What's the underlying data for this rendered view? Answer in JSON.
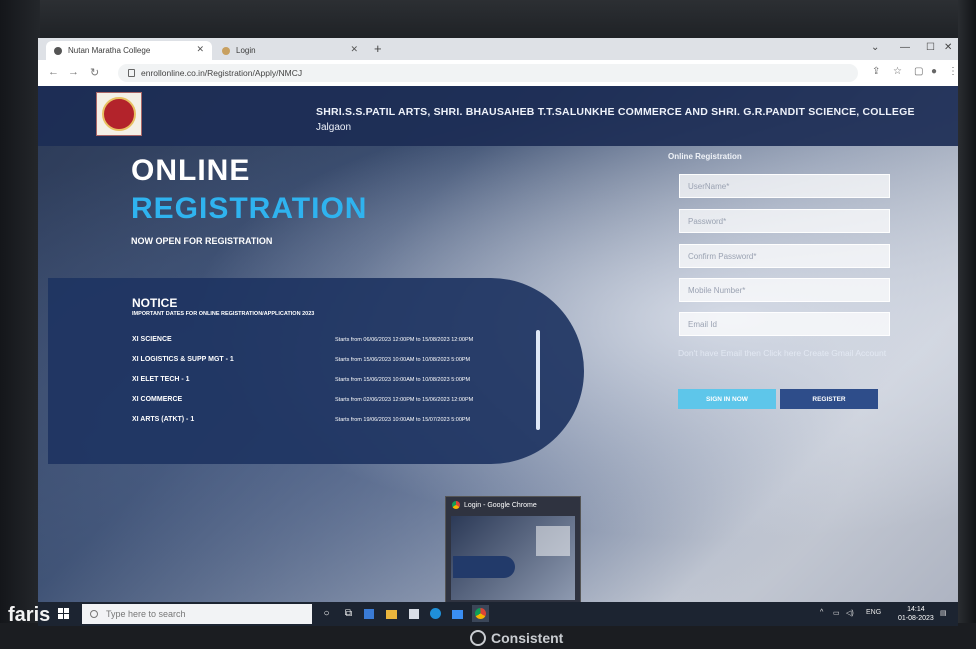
{
  "browser": {
    "tabs": [
      {
        "label": "Nutan Maratha College"
      },
      {
        "label": "Login"
      }
    ],
    "new_tab": "+",
    "url": "enrollonline.co.in/Registration/Apply/NMCJ",
    "window_controls": {
      "minimize": "—",
      "maximize": "☐",
      "close": "✕"
    }
  },
  "header": {
    "college_name": "SHRI.S.S.PATIL ARTS, SHRI. BHAUSAHEB T.T.SALUNKHE COMMERCE AND SHRI. G.R.PANDIT SCIENCE, COLLEGE",
    "city": "Jalgaon"
  },
  "hero": {
    "line1": "ONLINE",
    "line2": "REGISTRATION",
    "line3": "NOW OPEN FOR REGISTRATION"
  },
  "notice": {
    "title": "NOTICE",
    "subtitle": "IMPORTANT DATES FOR ONLINE REGISTRATION/APPLICATION 2023",
    "rows": [
      {
        "course": "XI SCIENCE",
        "dates": "Starts from 06/06/2023 12:00PM to 15/08/2023 12:00PM"
      },
      {
        "course": "XI LOGISTICS & SUPP MGT - 1",
        "dates": "Starts from 15/06/2023 10:00AM to 10/08/2023 5:00PM"
      },
      {
        "course": "XI ELET TECH - 1",
        "dates": "Starts from 15/06/2023 10:00AM to 10/08/2023 5:00PM"
      },
      {
        "course": "XI COMMERCE",
        "dates": "Starts from 02/06/2023 12:00PM to 15/06/2023 12:00PM"
      },
      {
        "course": "XI ARTS (ATKT) - 1",
        "dates": "Starts from 19/06/2023 10:00AM to 15/07/2023 5:00PM"
      }
    ]
  },
  "form": {
    "title": "Online Registration",
    "username_placeholder": "UserName*",
    "password_placeholder": "Password*",
    "confirm_password_placeholder": "Confirm Password*",
    "mobile_placeholder": "Mobile Number*",
    "email_placeholder": "Email Id",
    "gmail_note": "Don't have Email then Click here Create Gmail Account",
    "signin_label": "SIGN IN NOW",
    "register_label": "REGISTER"
  },
  "thumbnail": {
    "title": "Login - Google Chrome"
  },
  "taskbar": {
    "search_placeholder": "Type here to search",
    "language": "ENG",
    "time": "14:14",
    "date": "01-08-2023"
  },
  "overlay": {
    "name": "faris",
    "monitor_brand": "Consistent"
  },
  "colors": {
    "header_bg": "#1c2d55",
    "accent": "#2fb3ef",
    "notice_bg": "#1e3462",
    "signin_btn": "#5ec6ea",
    "register_btn": "#2e4d8a"
  }
}
